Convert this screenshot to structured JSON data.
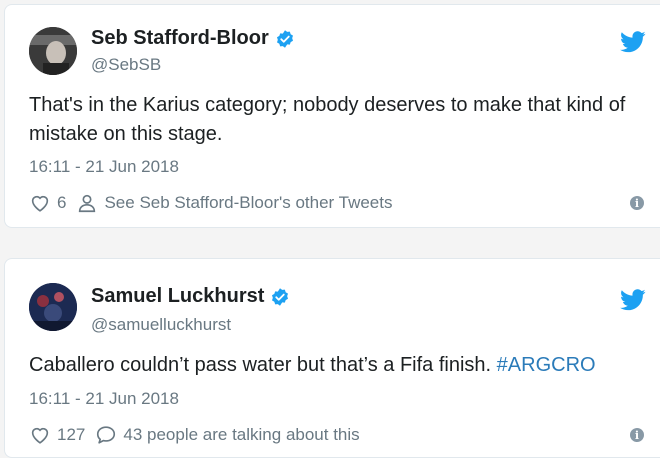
{
  "tweets": [
    {
      "author_name": "Seb Stafford-Bloor",
      "handle": "@SebSB",
      "text": "That's in the Karius category; nobody deserves to make that kind of mistake on this stage.",
      "timestamp": "16:11 - 21 Jun 2018",
      "likes": "6",
      "secondary_action": "See Seb Stafford-Bloor's other Tweets",
      "secondary_icon": "person-icon",
      "verified": true
    },
    {
      "author_name": "Samuel Luckhurst",
      "handle": "@samuelluckhurst",
      "text_main": "Caballero couldn’t pass water but that’s a Fifa finish. ",
      "hashtag": "#ARGCRO",
      "timestamp": "16:11 - 21 Jun 2018",
      "likes": "127",
      "secondary_action": "43 people are talking about this",
      "secondary_icon": "comment-icon",
      "verified": true
    }
  ],
  "colors": {
    "twitter_blue": "#1da1f2",
    "link_blue": "#2b7bb9",
    "muted_text": "#697882",
    "card_border": "#e1e8ed",
    "background": "#f4f4f4"
  },
  "info_icon_glyph": "i"
}
